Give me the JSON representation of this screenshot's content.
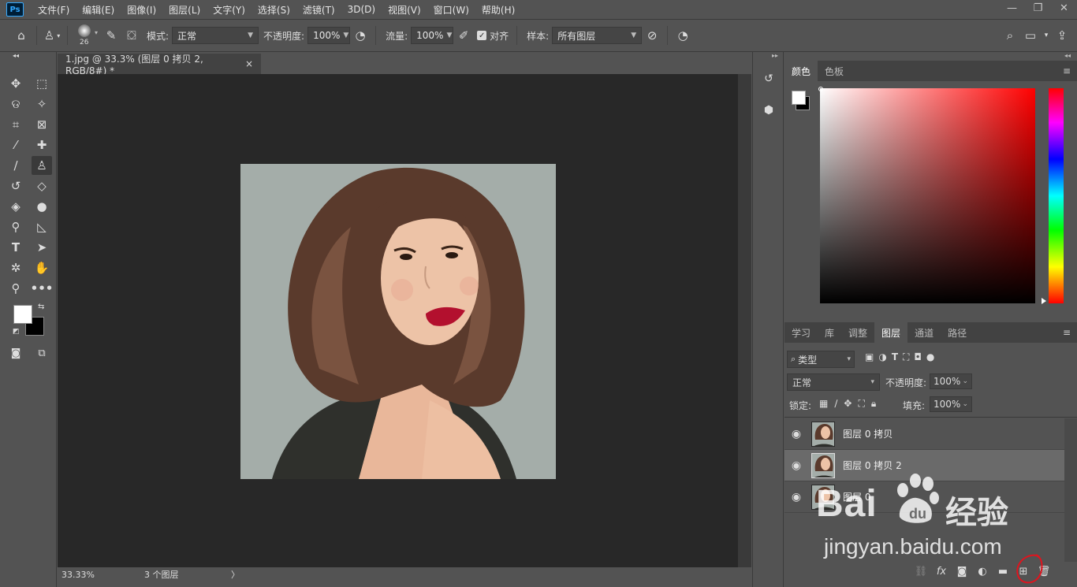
{
  "app": {
    "logo": "Ps"
  },
  "menu": [
    "文件(F)",
    "编辑(E)",
    "图像(I)",
    "图层(L)",
    "文字(Y)",
    "选择(S)",
    "滤镜(T)",
    "3D(D)",
    "视图(V)",
    "窗口(W)",
    "帮助(H)"
  ],
  "window_controls": {
    "minimize": "—",
    "restore": "❐",
    "close": "✕"
  },
  "options": {
    "brush_size": "26",
    "mode_label": "模式:",
    "mode_value": "正常",
    "opacity_label": "不透明度:",
    "opacity_value": "100%",
    "flow_label": "流量:",
    "flow_value": "100%",
    "aligned_label": "对齐",
    "sample_label": "样本:",
    "sample_value": "所有图层"
  },
  "document": {
    "tab_title": "1.jpg @ 33.3% (图层 0 拷贝 2, RGB/8#) *",
    "close": "×",
    "zoom": "33.33%",
    "status": "3 个图层",
    "status_arrow": "〉"
  },
  "color_panel": {
    "tabs": [
      "颜色",
      "色板"
    ],
    "active_tab": "颜色",
    "foreground": "#ffffff",
    "background": "#000000"
  },
  "layers_panel": {
    "tabs": [
      "学习",
      "库",
      "调整",
      "图层",
      "通道",
      "路径"
    ],
    "active_tab": "图层",
    "filter_label": "类型",
    "blend_mode": "正常",
    "opacity_label": "不透明度:",
    "opacity_value": "100%",
    "lock_label": "锁定:",
    "fill_label": "填充:",
    "fill_value": "100%",
    "layers": [
      {
        "name": "图层 0 拷贝",
        "selected": false
      },
      {
        "name": "图层 0 拷贝 2",
        "selected": true
      },
      {
        "name": "图层 0",
        "selected": false
      }
    ],
    "bottom_icons": [
      "link-icon",
      "fx-icon",
      "mask-icon",
      "adjustment-icon",
      "group-folder-icon",
      "new-layer-icon",
      "trash-icon"
    ]
  },
  "watermark": {
    "brand": "Bai",
    "brand_cn": "经验",
    "url": "jingyan.baidu.com"
  },
  "annotation": {
    "color": "#e0141e"
  }
}
